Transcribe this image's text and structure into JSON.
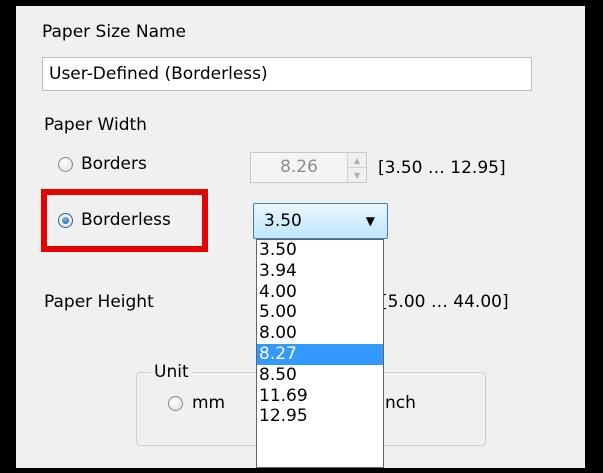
{
  "paper_size_name": {
    "label": "Paper Size Name",
    "value": "User-Defined (Borderless)"
  },
  "paper_width": {
    "label": "Paper Width",
    "borders_label": "Borders",
    "borders_value": "8.26",
    "borders_range": "[3.50 … 12.95]",
    "borderless_label": "Borderless",
    "borderless_selected_value": "3.50",
    "selected_option": "Borderless",
    "dropdown_options": [
      "3.50",
      "3.94",
      "4.00",
      "5.00",
      "8.00",
      "8.27",
      "8.50",
      "11.69",
      "12.95"
    ],
    "highlighted_option": "8.27"
  },
  "paper_height": {
    "label": "Paper Height",
    "range": "[5.00 … 44.00]"
  },
  "unit": {
    "legend": "Unit",
    "mm_label": "mm",
    "inch_label_partial": "nch"
  },
  "colors": {
    "highlight_box": "#e60000",
    "selection": "#3399ff"
  },
  "icons": {
    "spin_up": "triangle-up-icon",
    "spin_down": "triangle-down-icon",
    "combo_arrow": "chevron-down-icon"
  }
}
